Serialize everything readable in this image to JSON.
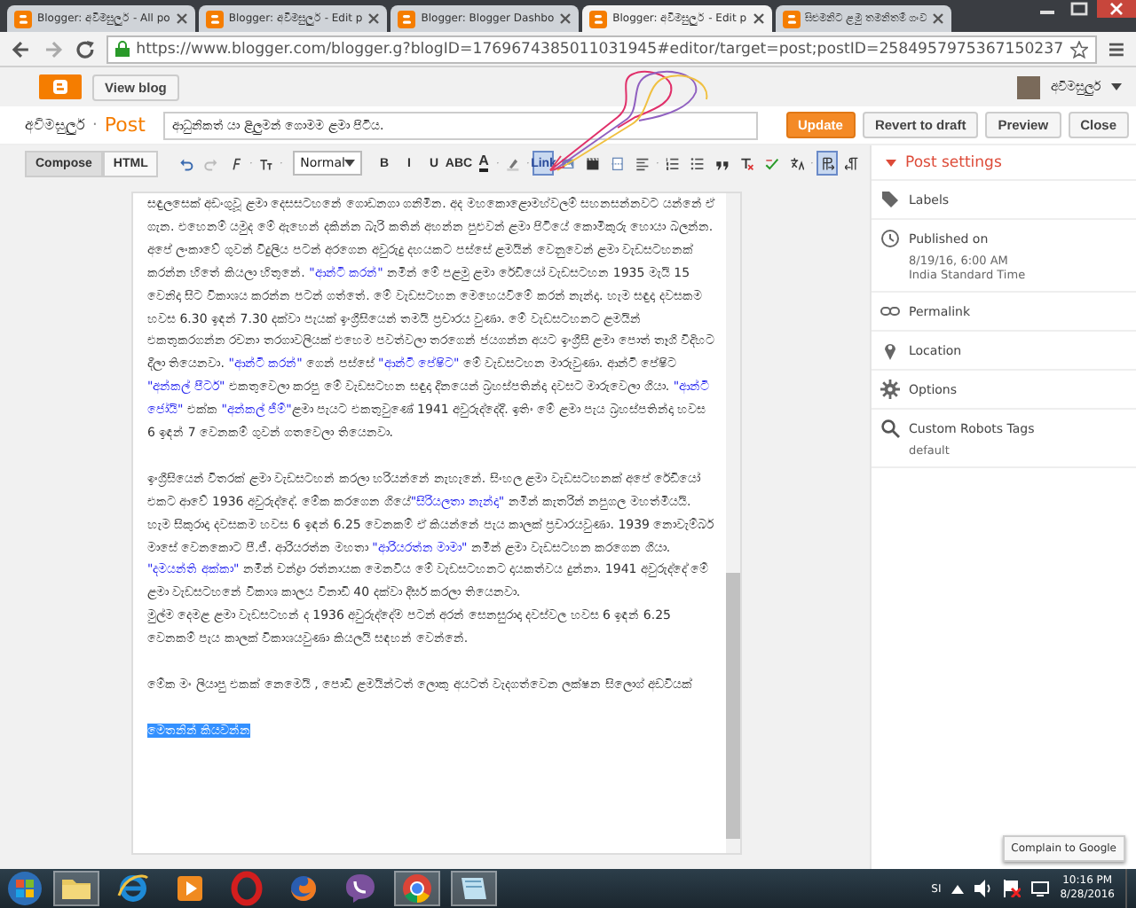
{
  "browser": {
    "tabs": [
      {
        "title": "Blogger: අවිමසුලුර් - All po",
        "selected": false
      },
      {
        "title": "Blogger: අවිමසුලුර් - Edit p",
        "selected": false
      },
      {
        "title": "Blogger: Blogger Dashbo",
        "selected": false
      },
      {
        "title": "Blogger: අවිමසුලුර් - Edit p",
        "selected": true
      },
      {
        "title": "සිළුමනිට ළමු තමනිතම් ගංව",
        "selected": false
      }
    ],
    "url": "https://www.blogger.com/blogger.g?blogID=1769674385011031945#editor/target=post;postID=2584957975367150237"
  },
  "header": {
    "view_blog": "View blog",
    "account_name": "අවිමසුලුර්"
  },
  "post_bar": {
    "blog_name": "අවිමසුලුර්",
    "separator": "·",
    "section": "Post",
    "title_value": "ආධුනිකත් යා ළිලුමන් ගොමම ළමා පිටිය.",
    "buttons": [
      {
        "label": "Update",
        "kind": "primary"
      },
      {
        "label": "Revert to draft",
        "kind": "normal"
      },
      {
        "label": "Preview",
        "kind": "normal"
      },
      {
        "label": "Close",
        "kind": "normal"
      }
    ]
  },
  "modes": [
    {
      "label": "Compose",
      "selected": true
    },
    {
      "label": "HTML",
      "selected": false
    }
  ],
  "tools": [
    {
      "kind": "undo",
      "active": false
    },
    {
      "kind": "redo",
      "active": false
    },
    {
      "kind": "font",
      "active": false
    },
    {
      "kind": "size",
      "active": false
    },
    {
      "kind": "format",
      "label": "Normal",
      "active": false
    },
    {
      "kind": "text",
      "label": "B",
      "active": false
    },
    {
      "kind": "text",
      "label": "I",
      "active": false
    },
    {
      "kind": "text",
      "label": "U",
      "active": false
    },
    {
      "kind": "text",
      "label": "ABC",
      "active": false
    },
    {
      "kind": "color",
      "label": "A",
      "active": false
    },
    {
      "kind": "highlight",
      "active": false
    },
    {
      "kind": "text",
      "label": "Link",
      "active": true
    },
    {
      "kind": "image",
      "active": false
    },
    {
      "kind": "video",
      "active": false
    },
    {
      "kind": "page",
      "active": false
    },
    {
      "kind": "align",
      "active": false
    },
    {
      "kind": "numbered",
      "active": false
    },
    {
      "kind": "bullets",
      "active": false
    },
    {
      "kind": "quote",
      "active": false
    },
    {
      "kind": "clear",
      "active": false
    },
    {
      "kind": "spell",
      "active": false
    },
    {
      "kind": "language",
      "active": false
    },
    {
      "kind": "ltr",
      "active": true
    },
    {
      "kind": "rtl",
      "active": false
    }
  ],
  "editor": {
    "paragraphs": [
      {
        "segments": [
          {
            "text": "සඳුලසෙක් අඩංගුවූ ළමා දෙසසටහනේ ගොඩනගා ගනිමින. අද මහකොළොමහ්වලම් සහනසන්නවට යන්නේ ඒ ගැන. එහෙනම් යමුද මේ ඇහෙන් දකින්න බැරි කතින් අහන්න පුළුවන් ළමා පිටියේ කොමිකුරු හොයා බලන්න.",
            "highlight": false
          }
        ]
      },
      {
        "segments": [
          {
            "text": "අපේ ලංකාවේ ගුවන් විදුලිය පටන් අරගෙන අවුරුදු දහයකට පස්සේ ළමයින් වෙනුවෙන් ළමා වැඩසටහනක් කරන්න හිතේ කියලා හිතුනේ. ",
            "highlight": false
          },
          {
            "text": "\"ආන්ටි කරන්\"",
            "highlight": true
          },
          {
            "text": " නමින් මේ පළමු ළමා රේඩියෝ වැඩසටහන 1935 මැයි 15 වෙනිදා සිට විකාශය කරන්න පටන් ගත්තේ. මේ වැඩසටහන මෙහෙයවීමේ කරන් නැන්දා. හැම සඳුදා දවසකම හවස 6.30 ඉඳන් 7.30 දක්වා පැයක් ඉංග්‍රීසියෙන් තමයි ප්‍රචාරය වුණා. මේ වැඩසටහනට ළමයින් එකතුකරගන්න රචනා තරගාවලියක් එහෙම පවත්වලා තරගෙන් ජයගන්න අයට ඉංග්‍රීසි ළමා පොත් තෑගි විදිහට දීලා තියෙනවා. ",
            "highlight": false
          },
          {
            "text": "\"ආන්ටි කරන්\"",
            "highlight": true
          },
          {
            "text": " ගෙන් පස්සේ ",
            "highlight": false
          },
          {
            "text": "\"ආන්ටි පේෂිට\"",
            "highlight": true
          },
          {
            "text": " මේ වැඩසටහන මාරුවුණා. ආන්ටි පේෂිට ",
            "highlight": false
          },
          {
            "text": "\"අන්කල් පීටර්\"",
            "highlight": true
          },
          {
            "text": " එකතුවෙලා කරපු මේ වැඩසටහන සඳුදා දිනයෙන් බ්‍රහස්පතින්දා දවසට මාරුවෙලා ගියා. ",
            "highlight": false
          },
          {
            "text": "\"ආන්ටි ජෝයි\"",
            "highlight": true
          },
          {
            "text": " එක්ක ",
            "highlight": false
          },
          {
            "text": "\"අන්කල් ජිම්\"",
            "highlight": true
          },
          {
            "text": "ළමා පැයට එකතුවුණේ 1941 අවුරුද්දේදී. ඉතිං මේ ළමා පැය බ්‍රහස්පතින්දා හවස 6 ඉඳන් 7 වෙනකම් ගුවන් ගතවෙලා තියෙනවා.",
            "highlight": false
          }
        ]
      },
      {
        "segments": [
          {
            "text": "ඉංග්‍රීසියෙන් විතරක් ළමා වැඩසටහන් කරලා හරියන්නේ නැහැනේ. සිංහල ළමා වැඩසටහනක් අපේ රේඩියෝ එකට ආවේ 1936 අවුරුද්දේ. මේක කරගෙන ගියේ",
            "highlight": false
          },
          {
            "text": "\"සිරියලතා නැන්දා\"",
            "highlight": true
          },
          {
            "text": " නමින් කැතරින් නපුගල මහත්මියයි. හැම සිකුරාදා දවසකම හවස 6 ඉඳන් 6.25 වෙනකම් ඒ කියන්නේ පැය කාලක් ප්‍රචාරයවුණා. 1939 නොවැම්බර් මාසේ වෙනකොට පී.ජී. ආරියරත්න මහතා ",
            "highlight": false
          },
          {
            "text": "\"ආරියරත්න මාමා\"",
            "highlight": true
          },
          {
            "text": " නමින් ළමා වැඩසටහන කරගෙන ගියා. ",
            "highlight": false
          },
          {
            "text": "\"දමයන්ති අක්කා\"",
            "highlight": true
          },
          {
            "text": " නමින් චන්ද්‍රා රත්නායක මෙනවිය මේ වැඩසටහනට දායකත්වය දුන්නා. 1941 අවුරුද්දේ මේ ළමා වැඩසටහනේ විකාශ කාලය විනාඩි 40 දක්වා දීර්ඝ කරලා තියෙනවා.",
            "highlight": false
          }
        ]
      },
      {
        "segments": [
          {
            "text": "මුල්ම දෙමළ ළමා වැඩසටහන් ද 1936 අවුරුද්දේම පටන් අරන් සෙනසුරාදා දවස්වල හවස 6 ඉඳන් 6.25 වෙනකම් පැය කාලක් විකාශයවුණා කියලයි සඳහන් වෙන්නේ.",
            "highlight": false
          }
        ]
      },
      {
        "segments": [
          {
            "text": "මේක මං ලියාපු එකක් නෙමෙයි , පොඩි ළමයින්ටත් ලොකු අයටත් වැදගත්වෙන ලක්ෂන සිලොග් අඩවියක්",
            "highlight": false
          }
        ]
      }
    ],
    "selected_text": "මෙතනින් කියවන්න"
  },
  "sidebar": {
    "title": "Post settings",
    "items": [
      {
        "kind": "labels",
        "label": "Labels"
      },
      {
        "kind": "published",
        "label": "Published on",
        "detail": "8/19/16, 6:00 AM",
        "detail_2": "India Standard Time"
      },
      {
        "kind": "permalink",
        "label": "Permalink"
      },
      {
        "kind": "location",
        "label": "Location"
      },
      {
        "kind": "options",
        "label": "Options"
      },
      {
        "kind": "robots",
        "label": "Custom Robots Tags",
        "detail": "default"
      }
    ]
  },
  "tooltip": "Complain to Google",
  "taskbar": {
    "apps": [
      {
        "kind": "explorer",
        "active": true
      },
      {
        "kind": "ie",
        "active": false
      },
      {
        "kind": "media",
        "active": false
      },
      {
        "kind": "opera",
        "active": false
      },
      {
        "kind": "firefox",
        "active": false
      },
      {
        "kind": "viber",
        "active": false
      },
      {
        "kind": "chrome",
        "active": true
      },
      {
        "kind": "notes",
        "active": true
      }
    ],
    "language": "SI",
    "time": "10:16 PM",
    "date": "8/28/2016"
  }
}
